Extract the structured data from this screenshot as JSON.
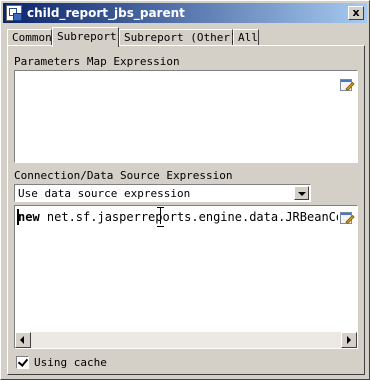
{
  "window": {
    "title": "child_report_jbs_parent",
    "close_glyph": "x"
  },
  "tabs": [
    {
      "label": "Common",
      "active": false
    },
    {
      "label": "Subreport",
      "active": true
    },
    {
      "label": "Subreport (Other)",
      "active": false
    },
    {
      "label": "All",
      "active": false
    }
  ],
  "parameters": {
    "label": "Parameters Map Expression",
    "value": ""
  },
  "connection": {
    "label": "Connection/Data Source Expression",
    "selected": "Use data source expression",
    "expression_keyword": "new",
    "expression_rest": " net.sf.jasperreports.engine.data.JRBeanCo"
  },
  "cache": {
    "label": "Using cache",
    "checked": true
  },
  "icons": {
    "app": "report-icon",
    "edit": "edit-expression-icon"
  }
}
